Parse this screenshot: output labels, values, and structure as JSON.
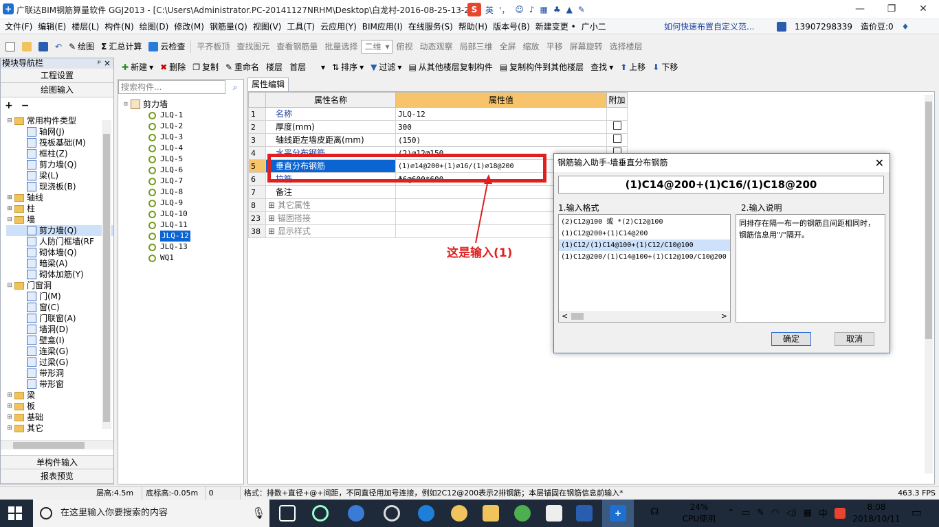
{
  "title_bar": {
    "app_title": "广联达BIM钢筋算量软件 GGJ2013 - [C:\\Users\\Administrator.PC-20141127NRHM\\Desktop\\白龙村-2016-08-25-13-27",
    "ime_letter": "S",
    "ime_lang": "英",
    "ime_punct": "'，"
  },
  "menu": [
    "文件(F)",
    "编辑(E)",
    "楼层(L)",
    "构件(N)",
    "绘图(D)",
    "修改(M)",
    "钢筋量(Q)",
    "视图(V)",
    "工具(T)",
    "云应用(Y)",
    "BIM应用(I)",
    "在线服务(S)",
    "帮助(H)",
    "版本号(B)",
    "新建变更 •",
    "广小二"
  ],
  "menu_tip": "如何快速布置自定义范...",
  "account": "13907298339",
  "price_points": "造价豆:0",
  "toolbar": {
    "draw": "绘图",
    "sum": "汇总计算",
    "cloud_check": "云检查",
    "align_slab": "平齐板顶",
    "find_elem": "查找图元",
    "view_rebar": "查看钢筋量",
    "batch_select": "批量选择",
    "view_mode": "二维",
    "top_view": "俯视",
    "dyn_view": "动态观察",
    "local_3d": "局部三维",
    "fullscreen": "全屏",
    "zoom": "缩放",
    "pan": "平移",
    "rotate": "屏幕旋转",
    "select_layer": "选择楼层"
  },
  "nav": {
    "header": "模块导航栏",
    "project_settings": "工程设置",
    "draw_input": "绘图输入",
    "single_input": "单构件输入",
    "report_preview": "报表预览",
    "tree": [
      {
        "label": "常用构件类型",
        "level": 0,
        "exp": "⊟",
        "kind": "folder"
      },
      {
        "label": "轴网(J)",
        "level": 1,
        "kind": "comp"
      },
      {
        "label": "筏板基础(M)",
        "level": 1,
        "kind": "comp"
      },
      {
        "label": "框柱(Z)",
        "level": 1,
        "kind": "comp"
      },
      {
        "label": "剪力墙(Q)",
        "level": 1,
        "kind": "comp"
      },
      {
        "label": "梁(L)",
        "level": 1,
        "kind": "comp"
      },
      {
        "label": "现浇板(B)",
        "level": 1,
        "kind": "comp"
      },
      {
        "label": "轴线",
        "level": 0,
        "exp": "⊞",
        "kind": "folder"
      },
      {
        "label": "柱",
        "level": 0,
        "exp": "⊞",
        "kind": "folder"
      },
      {
        "label": "墙",
        "level": 0,
        "exp": "⊟",
        "kind": "folder"
      },
      {
        "label": "剪力墙(Q)",
        "level": 1,
        "kind": "comp",
        "sel": true
      },
      {
        "label": "人防门框墙(RF",
        "level": 1,
        "kind": "comp"
      },
      {
        "label": "砌体墙(Q)",
        "level": 1,
        "kind": "comp"
      },
      {
        "label": "暗梁(A)",
        "level": 1,
        "kind": "comp"
      },
      {
        "label": "砌体加筋(Y)",
        "level": 1,
        "kind": "comp"
      },
      {
        "label": "门窗洞",
        "level": 0,
        "exp": "⊟",
        "kind": "folder"
      },
      {
        "label": "门(M)",
        "level": 1,
        "kind": "comp"
      },
      {
        "label": "窗(C)",
        "level": 1,
        "kind": "comp"
      },
      {
        "label": "门联窗(A)",
        "level": 1,
        "kind": "comp"
      },
      {
        "label": "墙洞(D)",
        "level": 1,
        "kind": "comp"
      },
      {
        "label": "壁龛(I)",
        "level": 1,
        "kind": "comp"
      },
      {
        "label": "连梁(G)",
        "level": 1,
        "kind": "comp"
      },
      {
        "label": "过梁(G)",
        "level": 1,
        "kind": "comp"
      },
      {
        "label": "带形洞",
        "level": 1,
        "kind": "comp"
      },
      {
        "label": "带形窗",
        "level": 1,
        "kind": "comp"
      },
      {
        "label": "梁",
        "level": 0,
        "exp": "⊞",
        "kind": "folder"
      },
      {
        "label": "板",
        "level": 0,
        "exp": "⊞",
        "kind": "folder"
      },
      {
        "label": "基础",
        "level": 0,
        "exp": "⊞",
        "kind": "folder"
      },
      {
        "label": "其它",
        "level": 0,
        "exp": "⊞",
        "kind": "folder"
      }
    ]
  },
  "comp_toolbar": {
    "new": "新建",
    "delete": "删除",
    "copy": "复制",
    "rename": "重命名",
    "floor_label": "楼层",
    "floor": "首层",
    "sort": "排序",
    "filter": "过滤",
    "copy_from": "从其他楼层复制构件",
    "copy_to": "复制构件到其他楼层",
    "find": "查找",
    "up": "上移",
    "down": "下移"
  },
  "search_placeholder": "搜索构件...",
  "comp_root": "剪力墙",
  "components": [
    "JLQ-1",
    "JLQ-2",
    "JLQ-3",
    "JLQ-4",
    "JLQ-5",
    "JLQ-6",
    "JLQ-7",
    "JLQ-8",
    "JLQ-9",
    "JLQ-10",
    "JLQ-11",
    "JLQ-12",
    "JLQ-13",
    "WQ1"
  ],
  "props": {
    "tab": "属性编辑",
    "h_name": "属性名称",
    "h_value": "属性值",
    "h_extra": "附加",
    "rows": [
      {
        "n": "1",
        "name": "名称",
        "val": "JLQ-12",
        "blue": true,
        "chk": false
      },
      {
        "n": "2",
        "name": "厚度(mm)",
        "val": "300",
        "chk": true
      },
      {
        "n": "3",
        "name": "轴线距左墙皮距离(mm)",
        "val": "(150)",
        "chk": true
      },
      {
        "n": "4",
        "name": "水平分布钢筋",
        "val": "(2)⌀12@150",
        "blue": true,
        "chk": true
      },
      {
        "n": "5",
        "name": "垂直分布钢筋",
        "val": "(1)⌀14@200+(1)⌀16/(1)⌀18@200",
        "blue": true,
        "sel": true
      },
      {
        "n": "6",
        "name": "拉筋",
        "val": "Φ6@600*600",
        "blue": true
      },
      {
        "n": "7",
        "name": "备注",
        "val": ""
      },
      {
        "n": "8",
        "name": "其它属性",
        "val": "",
        "grey": true,
        "plus": true
      },
      {
        "n": "23",
        "name": "锚固搭接",
        "val": "",
        "grey": true,
        "plus": true
      },
      {
        "n": "38",
        "name": "显示样式",
        "val": "",
        "grey": true,
        "plus": true
      }
    ]
  },
  "annotation": "这是输入(1)",
  "dialog": {
    "title": "钢筋输入助手-墙垂直分布钢筋",
    "expr": "(1)C14@200+(1)C16/(1)C18@200",
    "fmt_label": "1.输入格式",
    "desc_label": "2.输入说明",
    "formats": [
      "(2)C12@100 或 *(2)C12@100",
      "(1)C12@200+(1)C14@200",
      "(1)C12/(1)C14@100+(1)C12/C10@100",
      "(1)C12@200/(1)C14@100+(1)C12@100/C10@200"
    ],
    "desc": "同排存在隔一布一的钢筋且间距相同时，钢筋信息用\"/\"隔开。",
    "ok": "确定",
    "cancel": "取消"
  },
  "status": {
    "floor_h": "层高:4.5m",
    "base_h": "底标高:-0.05m",
    "num": "0",
    "hint": "格式：排数+直径+@+间距，不同直径用加号连接，例如2C12@200表示2排钢筋；本层锚固在钢筋信息前输入*",
    "fps": "463.3 FPS"
  },
  "taskbar": {
    "search": "在这里输入你要搜索的内容",
    "cpu_pct": "24%",
    "cpu_label": "CPU使用",
    "ime": "中",
    "time": "8:08",
    "date": "2018/10/11"
  },
  "colors": {
    "accent_red": "#e02020",
    "selection_blue": "#0a64d2"
  }
}
